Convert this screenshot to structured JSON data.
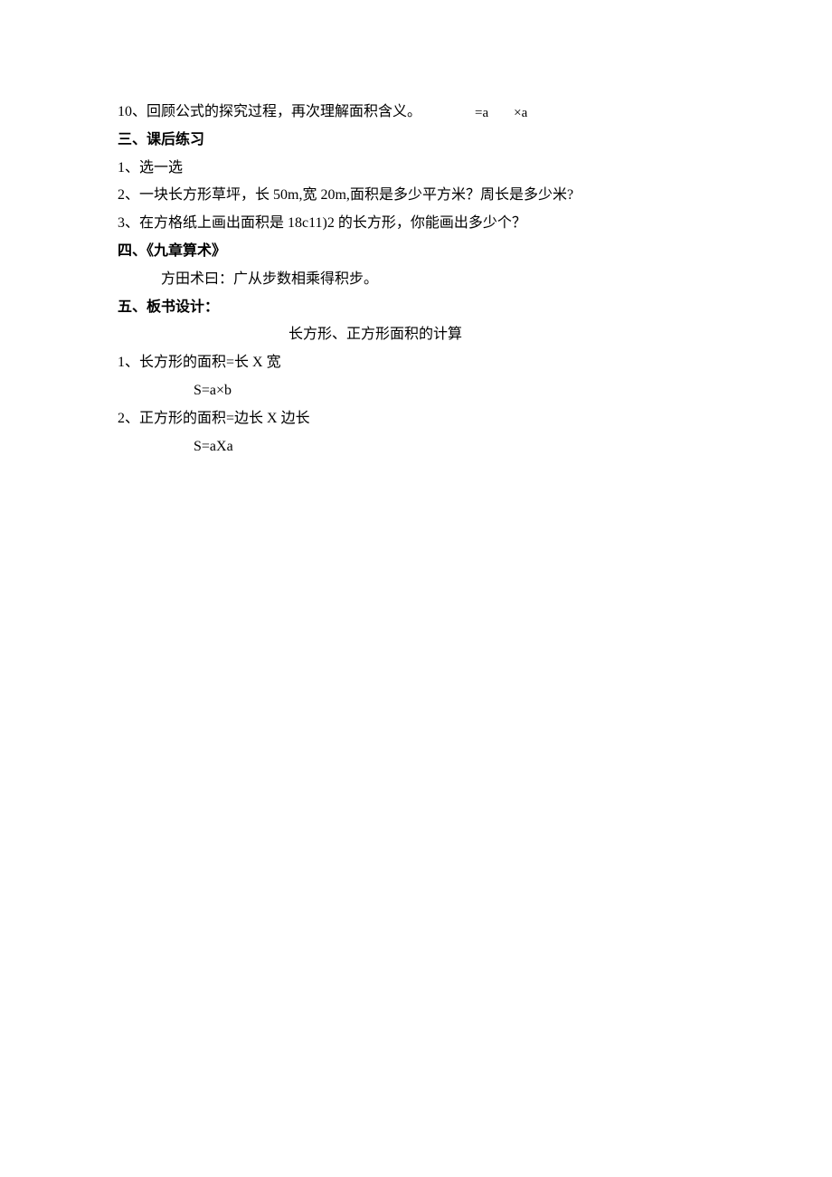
{
  "topFormula": {
    "left": "=a",
    "right": "×a"
  },
  "lines": {
    "l10": "10、回顾公式的探究过程，再次理解面积含义。",
    "h3": "三、课后练习",
    "l3_1": "1、选一选",
    "l3_2_pre": "2、一块长方形草坪，长 ",
    "l3_2_50m": "50m,",
    "l3_2_mid": "宽 ",
    "l3_2_20m": "20m,",
    "l3_2_post": "面积是多少平方米？周长是多少米?",
    "l3_3_pre": "3、在方格纸上画出面积是 ",
    "l3_3_val": "18c11)2",
    "l3_3_post": " 的长方形，你能画出多少个？",
    "h4": "四、《九章算术》",
    "l4_1": "方田术曰：广从步数相乘得积步。",
    "h5": "五、板书设计：",
    "l5_title": "长方形、正方形面积的计算",
    "l5_1": "1、长方形的面积=长 X 宽",
    "l5_1_formula": "S=a×b",
    "l5_2": "2、正方形的面积=边长 X 边长",
    "l5_2_formula": "S=aXa"
  }
}
